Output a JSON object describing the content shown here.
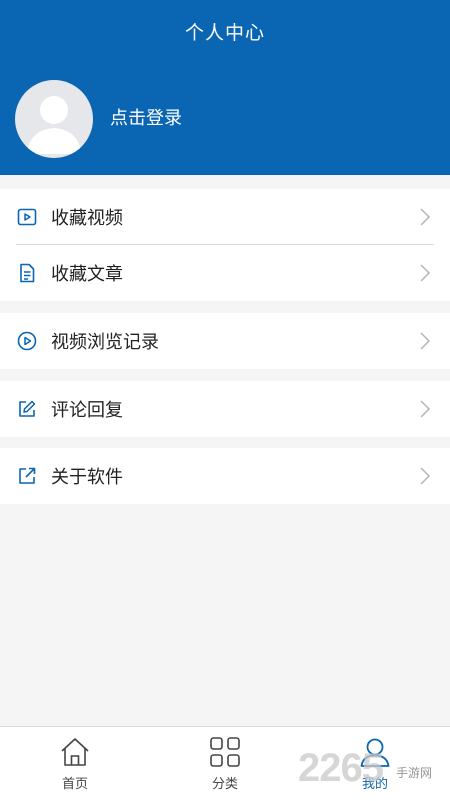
{
  "colors": {
    "brand": "#0a66b2",
    "background": "#f5f5f5"
  },
  "header": {
    "title": "个人中心",
    "login_text": "点击登录"
  },
  "menu": [
    {
      "label": "收藏视频",
      "icon": "video-icon"
    },
    {
      "label": "收藏文章",
      "icon": "document-icon"
    },
    {
      "label": "视频浏览记录",
      "icon": "play-circle-icon"
    },
    {
      "label": "评论回复",
      "icon": "edit-icon"
    },
    {
      "label": "关于软件",
      "icon": "external-link-icon"
    }
  ],
  "bottom_nav": [
    {
      "label": "首页",
      "icon": "home-icon",
      "active": false
    },
    {
      "label": "分类",
      "icon": "grid-icon",
      "active": false
    },
    {
      "label": "我的",
      "icon": "user-icon",
      "active": true
    }
  ],
  "watermark": {
    "number": "2265",
    "text": "手游网"
  }
}
